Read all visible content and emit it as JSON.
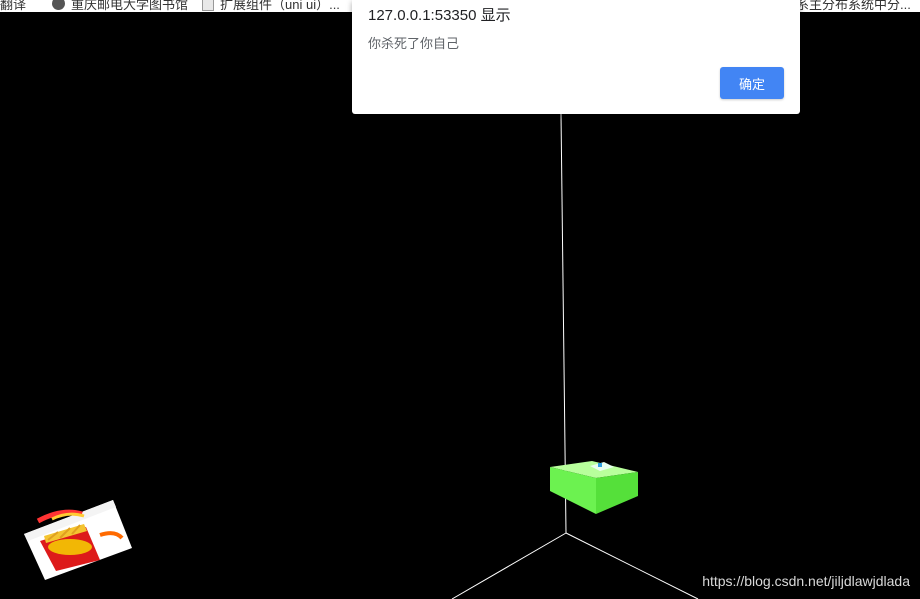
{
  "bookmarks": {
    "items": [
      {
        "label": "翻译",
        "icon": "translate-icon"
      },
      {
        "label": "重庆邮电大学图书馆",
        "icon": "globe-icon"
      },
      {
        "label": "扩展组件（uni ui）...",
        "icon": "document-icon"
      },
      {
        "label": "系主分布系统中分..."
      }
    ]
  },
  "dialog": {
    "title": "127.0.0.1:53350 显示",
    "message": "你杀死了你自己",
    "ok_label": "确定",
    "ok_color": "#4285f4"
  },
  "scene": {
    "background": "#000000",
    "axis_color": "#ffffff",
    "player_cube_color": "#66ff44",
    "item_cube": "fries-cube"
  },
  "watermark": {
    "text": "https://blog.csdn.net/jiljdlawjdlada"
  }
}
